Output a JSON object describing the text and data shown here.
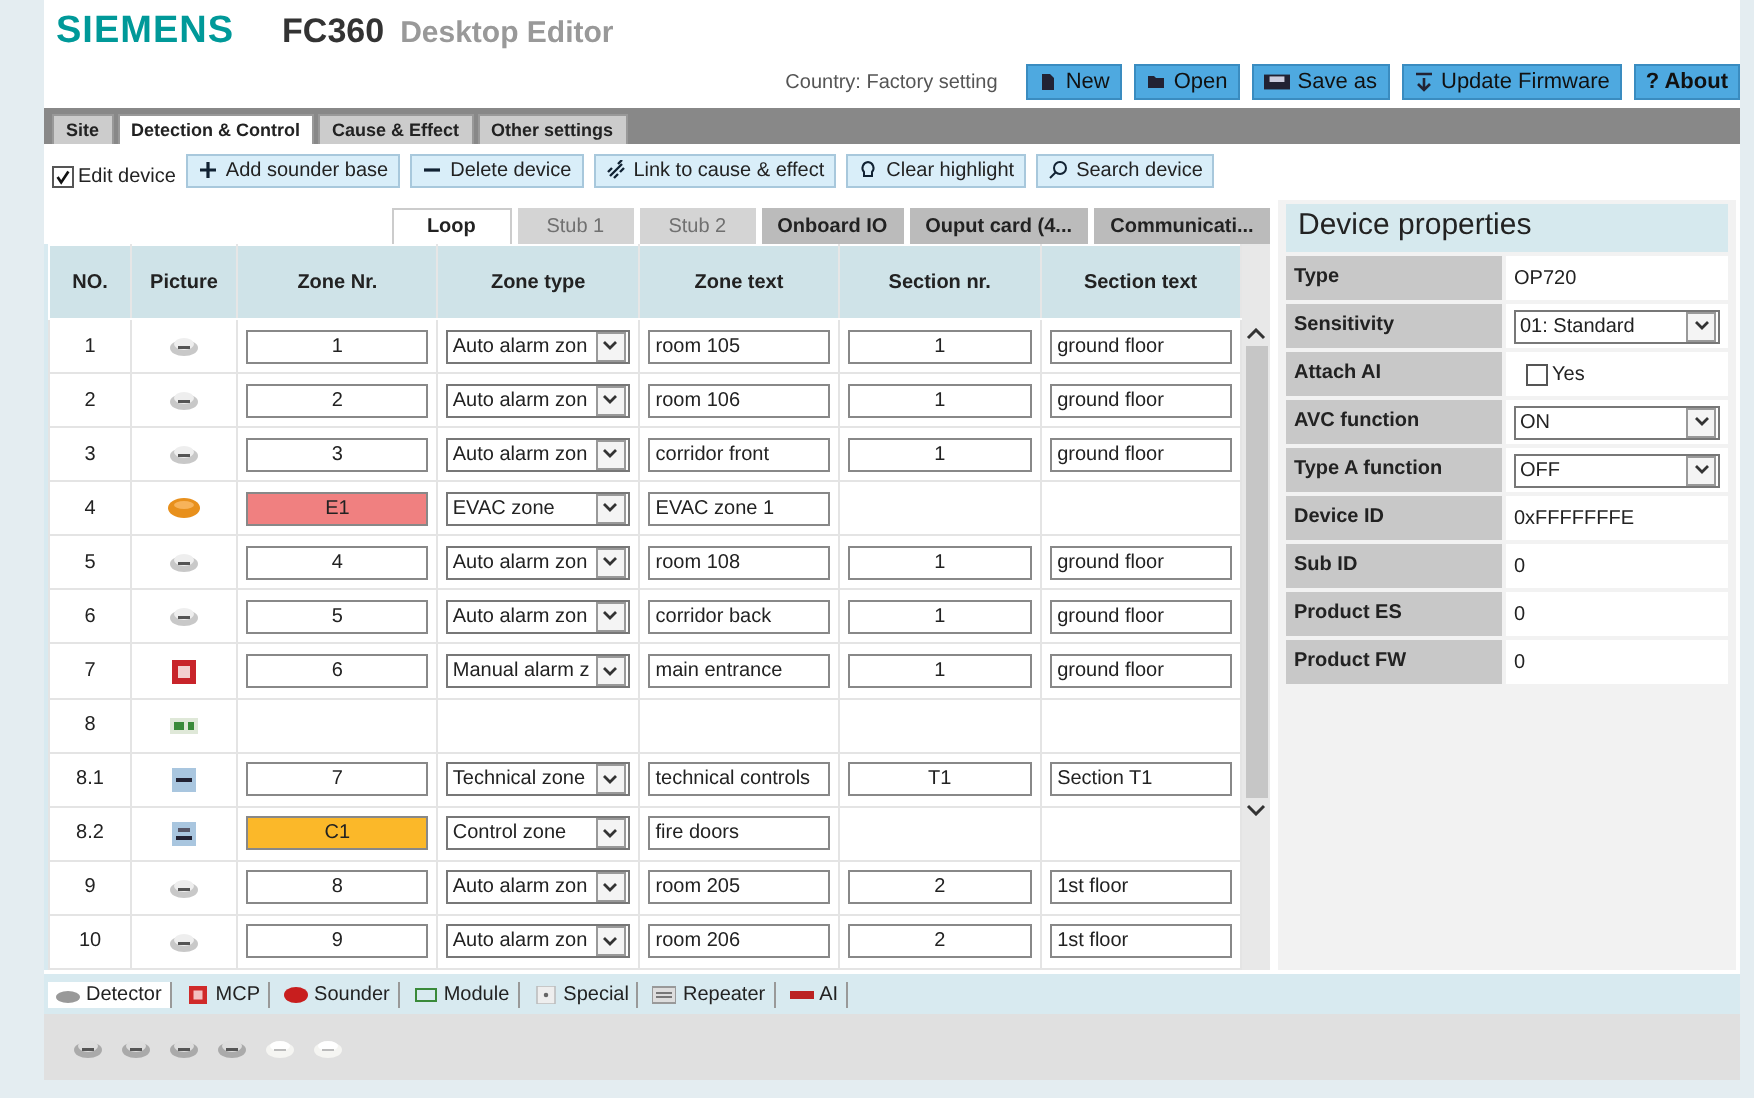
{
  "header": {
    "brand": "SIEMENS",
    "product": "FC360",
    "subtitle": "Desktop Editor",
    "country": "Country: Factory setting",
    "buttons": [
      {
        "label": "New"
      },
      {
        "label": "Open"
      },
      {
        "label": "Save as"
      },
      {
        "label": "Update Firmware"
      },
      {
        "label": "? About"
      }
    ]
  },
  "tabs": [
    {
      "label": "Site",
      "selected": false
    },
    {
      "label": "Detection & Control",
      "selected": true
    },
    {
      "label": "Cause & Effect",
      "selected": false
    },
    {
      "label": "Other settings",
      "selected": false
    }
  ],
  "toolbar": {
    "edit_device": {
      "label": "Edit device",
      "checked": true
    },
    "buttons": [
      {
        "label": "Add sounder base"
      },
      {
        "label": "Delete device"
      },
      {
        "label": "Link to cause & effect"
      },
      {
        "label": "Clear highlight"
      },
      {
        "label": "Search device"
      }
    ]
  },
  "loop_tabs": [
    {
      "label": "Loop",
      "selected": true,
      "disabled": false
    },
    {
      "label": "Stub 1",
      "selected": false,
      "disabled": true
    },
    {
      "label": "Stub 2",
      "selected": false,
      "disabled": true
    },
    {
      "label": "Onboard IO",
      "selected": false,
      "disabled": false
    },
    {
      "label": "Ouput card (4...",
      "selected": false,
      "disabled": false
    },
    {
      "label": "Communicati...",
      "selected": false,
      "disabled": false
    }
  ],
  "table": {
    "columns": [
      "NO.",
      "Picture",
      "Zone Nr.",
      "Zone type",
      "Zone text",
      "Section nr.",
      "Section text"
    ],
    "rows": [
      {
        "no": "1",
        "kind": "detector",
        "zone_nr": "1",
        "zone_type": "Auto alarm zon",
        "zone_text": "room 105",
        "section_nr": "1",
        "section_text": "ground floor"
      },
      {
        "no": "2",
        "kind": "detector",
        "zone_nr": "2",
        "zone_type": "Auto alarm zon",
        "zone_text": "room 106",
        "section_nr": "1",
        "section_text": "ground floor"
      },
      {
        "no": "3",
        "kind": "detector",
        "zone_nr": "3",
        "zone_type": "Auto alarm zon",
        "zone_text": "corridor front",
        "section_nr": "1",
        "section_text": "ground floor"
      },
      {
        "no": "4",
        "kind": "sounder",
        "zone_nr": "E1",
        "color": "#f08080",
        "zone_type": "EVAC zone",
        "zone_text": "EVAC zone 1"
      },
      {
        "no": "5",
        "kind": "detector",
        "zone_nr": "4",
        "zone_type": "Auto alarm zon",
        "zone_text": "room 108",
        "section_nr": "1",
        "section_text": "ground floor"
      },
      {
        "no": "6",
        "kind": "detector",
        "zone_nr": "5",
        "zone_type": "Auto alarm zon",
        "zone_text": "corridor back",
        "section_nr": "1",
        "section_text": "ground floor"
      },
      {
        "no": "7",
        "kind": "mcp",
        "zone_nr": "6",
        "zone_type": "Manual alarm z",
        "zone_text": "main entrance",
        "section_nr": "1",
        "section_text": "ground floor"
      },
      {
        "no": "8",
        "kind": "module"
      },
      {
        "no": "8.1",
        "kind": "technical",
        "zone_nr": "7",
        "zone_type": "Technical zone",
        "zone_text": "technical controls",
        "section_nr": "T1",
        "section_text": "Section T1"
      },
      {
        "no": "8.2",
        "kind": "control",
        "zone_nr": "C1",
        "color": "#fbb829",
        "zone_type": "Control zone",
        "zone_text": "fire doors"
      },
      {
        "no": "9",
        "kind": "detector",
        "zone_nr": "8",
        "zone_type": "Auto alarm zon",
        "zone_text": "room 205",
        "section_nr": "2",
        "section_text": "1st floor"
      },
      {
        "no": "10",
        "kind": "detector",
        "zone_nr": "9",
        "zone_type": "Auto alarm zon",
        "zone_text": "room 206",
        "section_nr": "2",
        "section_text": "1st floor"
      }
    ]
  },
  "device_properties": {
    "title": "Device properties",
    "rows": [
      {
        "label": "Type",
        "kind": "text",
        "value": "OP720"
      },
      {
        "label": "Sensitivity",
        "kind": "select",
        "value": "01: Standard"
      },
      {
        "label": "Attach AI",
        "kind": "checkbox",
        "value": "Yes",
        "checked": false
      },
      {
        "label": "AVC function",
        "kind": "select",
        "value": "ON"
      },
      {
        "label": "Type A function",
        "kind": "select",
        "value": "OFF"
      },
      {
        "label": "Device ID",
        "kind": "text",
        "value": "0xFFFFFFFE"
      },
      {
        "label": "Sub ID",
        "kind": "text",
        "value": "0"
      },
      {
        "label": "Product ES",
        "kind": "text",
        "value": "0"
      },
      {
        "label": "Product FW",
        "kind": "text",
        "value": "0"
      }
    ]
  },
  "palette_tabs": [
    {
      "label": "Detector",
      "selected": true
    },
    {
      "label": "MCP",
      "selected": false
    },
    {
      "label": "Sounder",
      "selected": false
    },
    {
      "label": "Module",
      "selected": false
    },
    {
      "label": "Special",
      "selected": false
    },
    {
      "label": "Repeater",
      "selected": false
    },
    {
      "label": "AI",
      "selected": false
    }
  ],
  "palette_items": [
    {
      "kind": "standard"
    },
    {
      "kind": "standard"
    },
    {
      "kind": "standard"
    },
    {
      "kind": "standard"
    },
    {
      "kind": "flat"
    },
    {
      "kind": "flat"
    }
  ]
}
